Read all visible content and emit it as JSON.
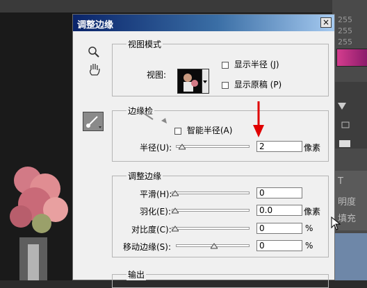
{
  "background": {
    "right_panel": {
      "values": [
        "255",
        "255",
        "255"
      ],
      "labels": [
        "T",
        "明度",
        "填充"
      ]
    }
  },
  "dialog": {
    "title": "调整边缘",
    "close_label": "×",
    "view_mode": {
      "legend": "视图模式",
      "view_label": "视图:",
      "show_radius": "显示半径 (J)",
      "show_original": "显示原稿 (P)"
    },
    "edge_detection": {
      "legend": "边缘检",
      "smart_radius": "智能半径(A)",
      "radius_label": "半径(U):",
      "radius_value": "2",
      "radius_unit": "像素"
    },
    "adjust_edge": {
      "legend": "调整边缘",
      "smooth_label": "平滑(H):",
      "smooth_value": "0",
      "feather_label": "羽化(E):",
      "feather_value": "0.0",
      "feather_unit": "像素",
      "contrast_label": "对比度(C):",
      "contrast_value": "0",
      "contrast_unit": "%",
      "shift_label": "移动边缘(S):",
      "shift_value": "0",
      "shift_unit": "%"
    },
    "output": {
      "legend": "输出"
    }
  },
  "colors": {
    "title_gradient_start": "#0a246a",
    "title_gradient_end": "#a6caf0",
    "dialog_bg": "#f0f0f0",
    "annotation_arrow": "#e00000"
  },
  "icons": [
    "zoom-icon",
    "hand-icon",
    "refine-radius-brush-icon",
    "dropdown-arrow-icon",
    "close-icon"
  ]
}
